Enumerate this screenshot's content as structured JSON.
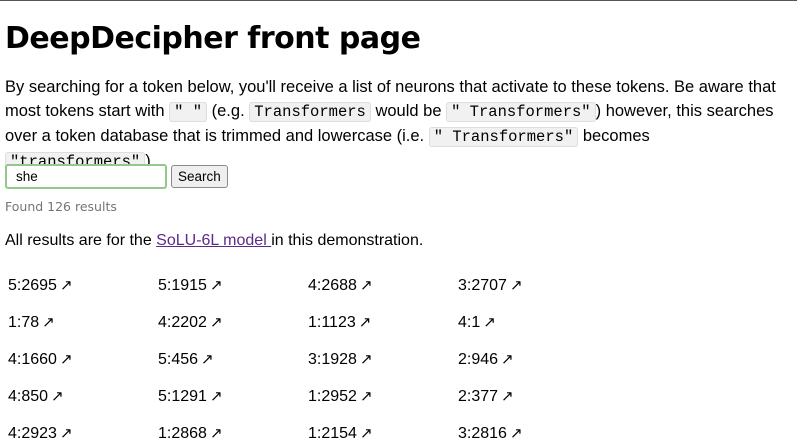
{
  "page": {
    "title": "DeepDecipher front page",
    "desc": {
      "t1": "By searching for a token below, you'll receive a list of neurons that activate to these tokens. Be aware that most tokens start with ",
      "c1": "\" \"",
      "t2": " (e.g. ",
      "c2": "Transformers",
      "t3": " would be ",
      "c3": "\" Transformers\"",
      "t4": ") however, this searches over a token database that is trimmed and lowercase (i.e. ",
      "c4": "\" Transformers\"",
      "t5": " becomes ",
      "c5": "\"transformers\"",
      "t6": ")."
    }
  },
  "search": {
    "value": "she",
    "button_label": "Search",
    "found_text": "Found 126 results"
  },
  "note": {
    "prefix": "All results are for the ",
    "link": "SoLU-6L model ",
    "suffix": "in this demonstration."
  },
  "results": {
    "arrow": "↗",
    "rows": [
      [
        "5:2695",
        "5:1915",
        "4:2688",
        "3:2707"
      ],
      [
        "1:78",
        "4:2202",
        "1:1123",
        "4:1"
      ],
      [
        "4:1660",
        "5:456",
        "3:1928",
        "2:946"
      ],
      [
        "4:850",
        "5:1291",
        "1:2952",
        "2:377"
      ],
      [
        "4:2923",
        "1:2868",
        "1:2154",
        "3:2816"
      ]
    ]
  },
  "colors": {
    "link": "#5b2b8a",
    "input_border": "#93c88b",
    "muted_text": "#757575"
  }
}
